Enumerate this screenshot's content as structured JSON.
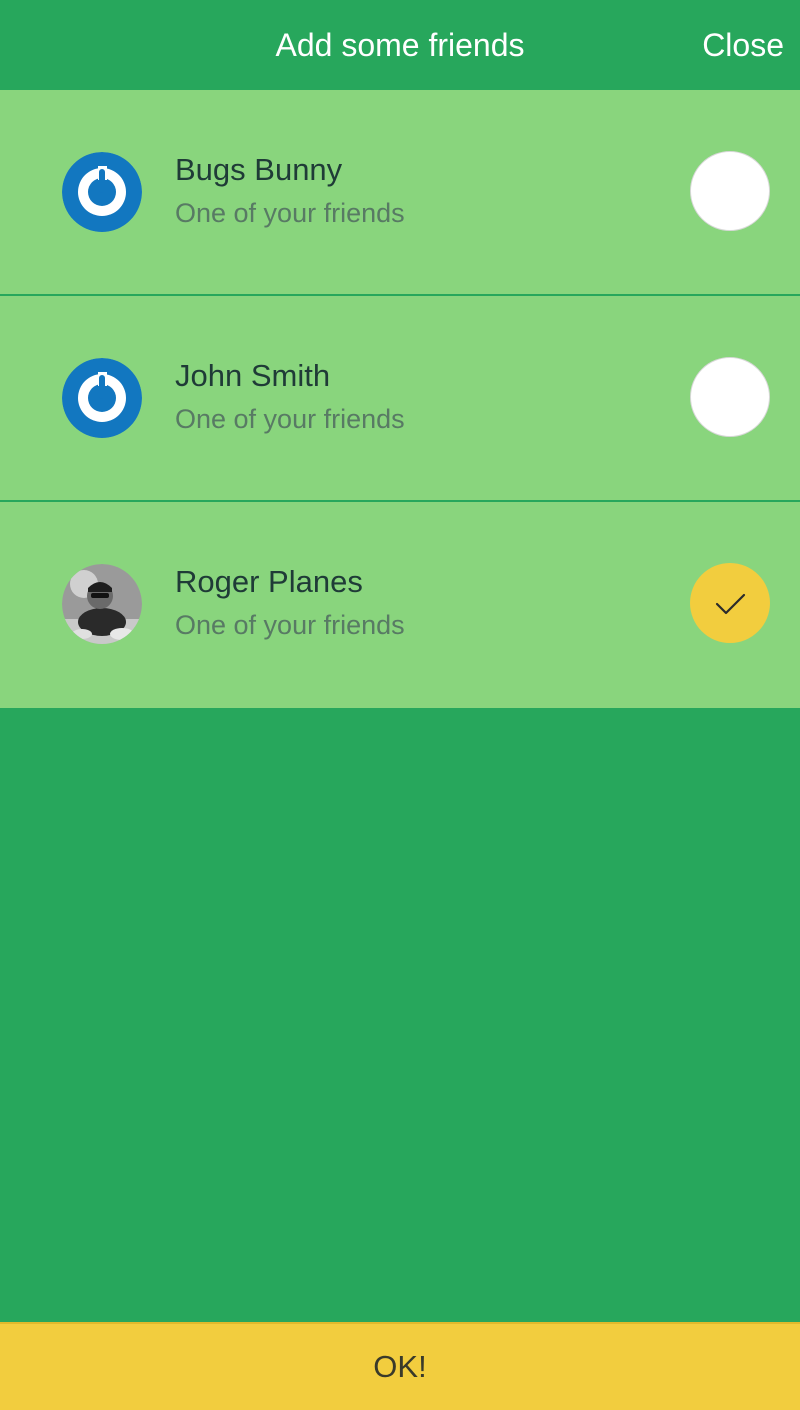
{
  "header": {
    "title": "Add some friends",
    "close_label": "Close"
  },
  "friends": [
    {
      "name": "Bugs Bunny",
      "subtitle": "One of your friends",
      "avatar": "power-logo-icon",
      "selected": false
    },
    {
      "name": "John Smith",
      "subtitle": "One of your friends",
      "avatar": "power-logo-icon",
      "selected": false
    },
    {
      "name": "Roger Planes",
      "subtitle": "One of your friends",
      "avatar": "user-photo",
      "selected": true
    }
  ],
  "footer": {
    "ok_label": "OK!"
  },
  "colors": {
    "background": "#27a75c",
    "row": "#89d57d",
    "accent": "#f2cd3e",
    "logo_blue": "#1277c0"
  }
}
